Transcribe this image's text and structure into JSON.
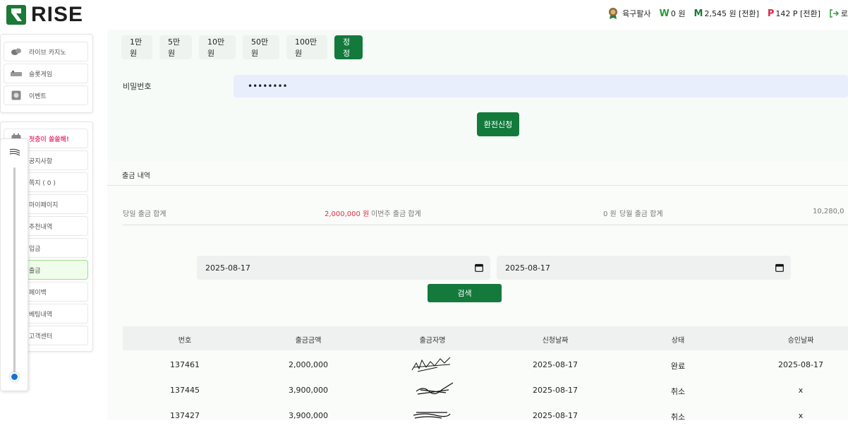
{
  "brand": {
    "name": "RISE",
    "color": "#1a7a36"
  },
  "user": {
    "name": "육구팔사",
    "won_label": "W",
    "won_balance": "0 원",
    "money_label": "M",
    "money_balance": "2,545 원 [전환]",
    "point_label": "P",
    "point_balance": "142 P [전환]",
    "logout_label": "로"
  },
  "sidebar": {
    "group1": [
      {
        "label": "라이브 카지노",
        "icon": "chips-icon"
      },
      {
        "label": "슬롯게임",
        "icon": "slot-icon"
      },
      {
        "label": "이벤트",
        "icon": "event-icon"
      }
    ],
    "group2": [
      {
        "label": "첫충이 쏠쏠해!",
        "icon": "gift-icon",
        "highlight": true
      },
      {
        "label": "공지사항"
      },
      {
        "label": "쪽지 ( 0 )"
      },
      {
        "label": "마이페이지"
      },
      {
        "label": "추천내역"
      },
      {
        "label": "입금"
      },
      {
        "label": "출금",
        "active": true
      },
      {
        "label": "페이백"
      },
      {
        "label": "베팅내역"
      },
      {
        "label": "고객센터"
      }
    ]
  },
  "amount_buttons": [
    "1만원",
    "5만원",
    "10만원",
    "50만원",
    "100만원"
  ],
  "correct_button": "정정",
  "password": {
    "label": "비밀번호",
    "value": "••••••••"
  },
  "submit_label": "환전신청",
  "history": {
    "title": "출금 내역",
    "daily_label": "당일 출금 합계",
    "daily_value": "2,000,000 원",
    "weekly_label": "이번주 출금 합계",
    "weekly_value": "0 원",
    "monthly_label": "당월 출금 합계",
    "monthly_value": "10,280,0"
  },
  "filter": {
    "start_date": "2025-08-17",
    "end_date": "2025-08-17",
    "search_label": "검색"
  },
  "table": {
    "headers": [
      "번호",
      "출금금액",
      "출금자명",
      "신청날짜",
      "상태",
      "승인날짜"
    ],
    "rows": [
      {
        "id": "137461",
        "amount": "2,000,000",
        "date": "2025-08-17",
        "status": "완료",
        "approved": "2025-08-17"
      },
      {
        "id": "137445",
        "amount": "3,900,000",
        "date": "2025-08-17",
        "status": "취소",
        "approved": "x"
      },
      {
        "id": "137427",
        "amount": "3,900,000",
        "date": "2025-08-17",
        "status": "취소",
        "approved": "x"
      }
    ]
  },
  "zoom_slider": {
    "level": 0.03
  }
}
